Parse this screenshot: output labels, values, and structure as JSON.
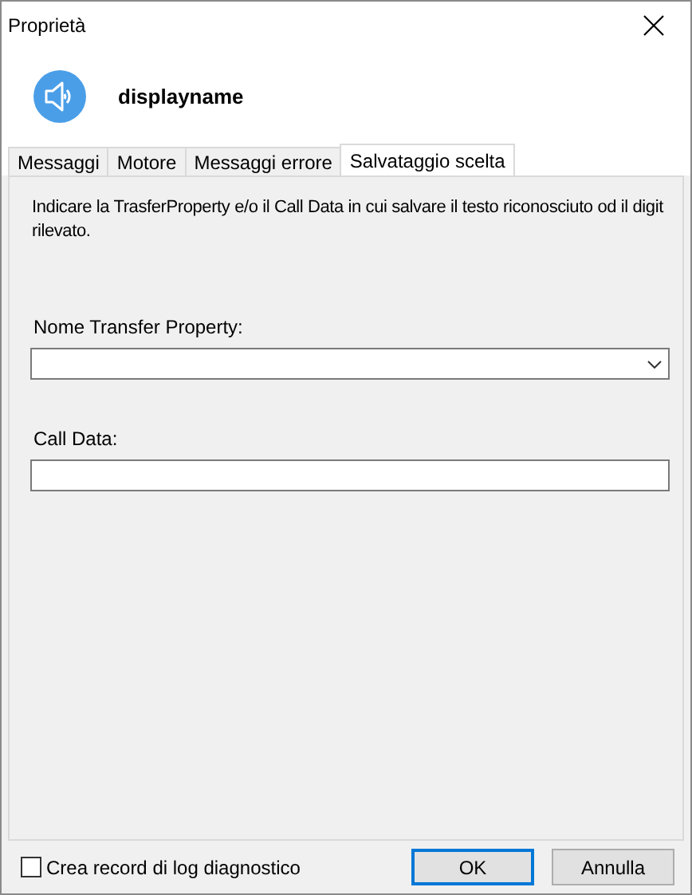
{
  "window": {
    "title": "Proprietà"
  },
  "header": {
    "name": "displayname"
  },
  "tabs": [
    {
      "label": "Messaggi",
      "selected": false
    },
    {
      "label": "Motore",
      "selected": false
    },
    {
      "label": "Messaggi errore",
      "selected": false
    },
    {
      "label": "Salvataggio scelta",
      "selected": true
    }
  ],
  "description": "Indicare la TrasferProperty e/o il Call Data in cui salvare il testo riconosciuto od il digit rilevato.",
  "fields": [
    {
      "kind": "combo",
      "label": "Nome Transfer Property:"
    },
    {
      "kind": "text",
      "label": "Call Data:"
    }
  ],
  "log_checkbox": {
    "label": "Crea record di log diagnostico",
    "checked": false
  },
  "buttons": [
    {
      "label": "OK",
      "default": true
    },
    {
      "label": "Annulla",
      "default": false
    }
  ]
}
